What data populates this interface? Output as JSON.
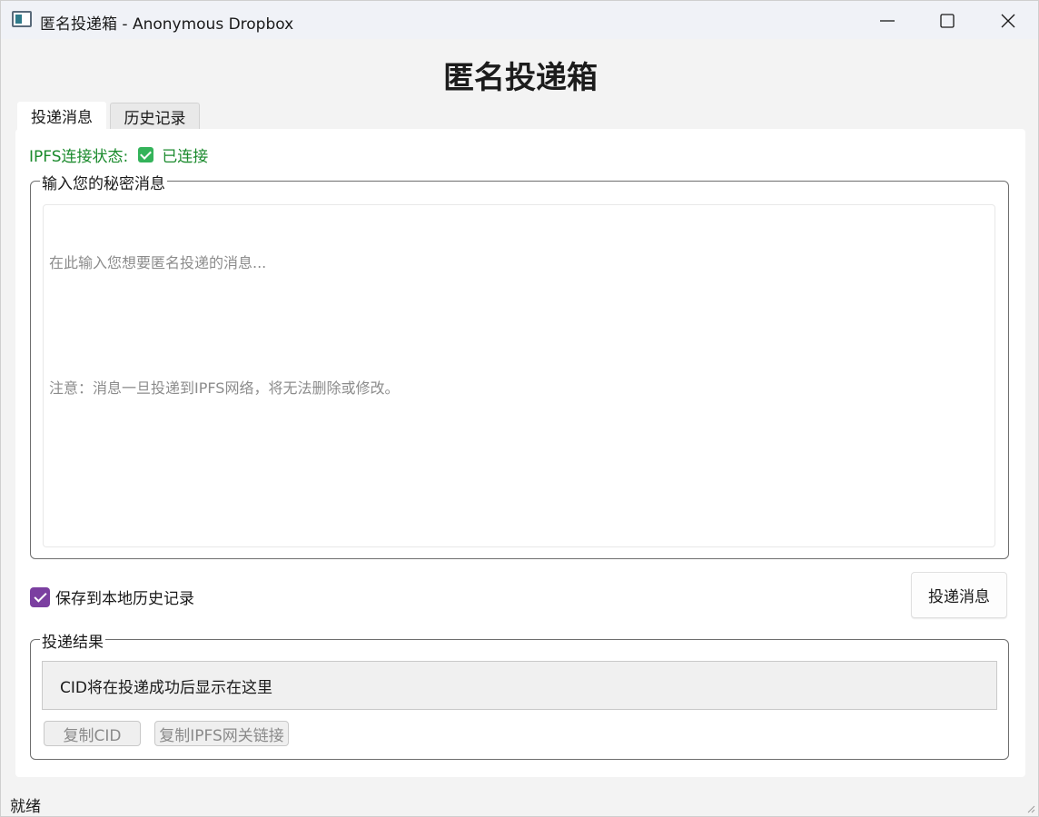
{
  "window": {
    "title": "匿名投递箱 - Anonymous Dropbox"
  },
  "header": {
    "title": "匿名投递箱"
  },
  "tabs": [
    {
      "label": "投递消息",
      "active": true
    },
    {
      "label": "历史记录",
      "active": false
    }
  ],
  "status": {
    "ipfs_label": "IPFS连接状态:",
    "ipfs_value": "已连接",
    "status_color": "#1a8a2c"
  },
  "message_group": {
    "label": "输入您的秘密消息",
    "placeholder_line1": "在此输入您想要匿名投递的消息...",
    "placeholder_line2": "注意：消息一旦投递到IPFS网络，将无法删除或修改。",
    "value": ""
  },
  "save_option": {
    "label": "保存到本地历史记录",
    "checked": true,
    "check_color": "#7b3fa0"
  },
  "submit_button": {
    "label": "投递消息"
  },
  "result_group": {
    "label": "投递结果",
    "cid_text": "CID将在投递成功后显示在这里",
    "copy_cid_label": "复制CID",
    "copy_link_label": "复制IPFS网关链接"
  },
  "status_bar": {
    "text": "就绪"
  },
  "icons": {
    "app": "app-window-icon",
    "minimize": "minimize-icon",
    "maximize": "maximize-icon",
    "close": "close-icon",
    "status_check": "check-icon"
  }
}
